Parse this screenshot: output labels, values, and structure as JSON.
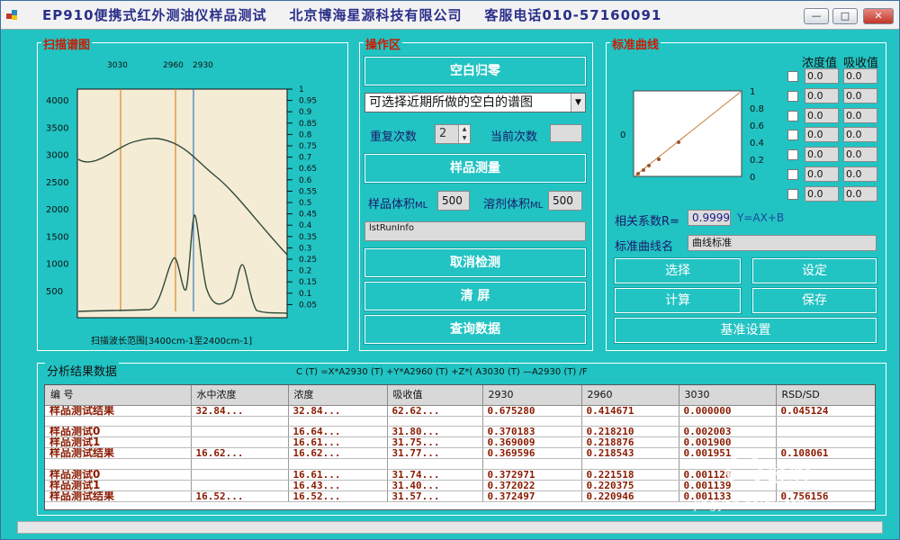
{
  "window": {
    "title": "EP910便携式红外测油仪样品测试    北京博海星源科技有限公司    客服电话010-57160091",
    "minimize": "—",
    "maximize": "□",
    "close": "✕"
  },
  "scan_panel": {
    "title": "扫描谱图",
    "caption": "扫描波长范围[3400cm-1至2400cm-1]",
    "markers": [
      "3030",
      "2960",
      "2930"
    ],
    "left_ticks": [
      "4000",
      "3500",
      "3000",
      "2500",
      "2000",
      "1500",
      "1000",
      "500"
    ],
    "right_ticks": [
      "1",
      "0.95",
      "0.9",
      "0.85",
      "0.8",
      "0.75",
      "0.7",
      "0.65",
      "0.6",
      "0.55",
      "0.5",
      "0.45",
      "0.4",
      "0.35",
      "0.3",
      "0.25",
      "0.2",
      "0.15",
      "0.1",
      "0.05"
    ]
  },
  "ops_panel": {
    "title": "操作区",
    "blank_zero_button": "空白归零",
    "blank_select_value": "可选择近期所做的空白的谱图",
    "repeat_label": "重复次数",
    "repeat_value": "2",
    "current_label": "当前次数",
    "current_value": "",
    "sample_measure_button": "样品测量",
    "sample_volume_label": "样品体积",
    "sample_volume_unit": "ML",
    "sample_volume_value": "500",
    "solvent_volume_label": "溶剂体积",
    "solvent_volume_unit": "ML",
    "solvent_volume_value": "500",
    "run_info": "lstRunInfo",
    "cancel_button": "取消检测",
    "clear_button": "清    屏",
    "query_button": "查询数据"
  },
  "curve_panel": {
    "title": "标准曲线",
    "conc_header": "浓度值",
    "abs_header": "吸收值",
    "rows": [
      {
        "conc": "0.0",
        "abs": "0.0"
      },
      {
        "conc": "0.0",
        "abs": "0.0"
      },
      {
        "conc": "0.0",
        "abs": "0.0"
      },
      {
        "conc": "0.0",
        "abs": "0.0"
      },
      {
        "conc": "0.0",
        "abs": "0.0"
      },
      {
        "conc": "0.0",
        "abs": "0.0"
      },
      {
        "conc": "0.0",
        "abs": "0.0"
      }
    ],
    "mini_left_tick": "0",
    "mini_right_ticks": [
      "1",
      "0.8",
      "0.6",
      "0.4",
      "0.2",
      "0"
    ],
    "r_label": "相关系数R=",
    "r_value": "0.9999",
    "equation": "Y=AX+B",
    "curve_name_label": "标准曲线名",
    "curve_name_value": "曲线标准",
    "select_button": "选择",
    "set_button": "设定",
    "calc_button": "计算",
    "save_button": "保存",
    "baseline_button": "基准设置"
  },
  "results": {
    "title": "分析结果数据",
    "formula": "C (T) =X*A2930 (T) +Y*A2960 (T) +Z*( A3030 (T) —A2930 (T) /F",
    "headers": [
      "编    号",
      "水中浓度",
      "浓度",
      "吸收值",
      "2930",
      "2960",
      "3030",
      "RSD/SD"
    ],
    "rows": [
      [
        "样品测试结果",
        "32.84...",
        "32.84...",
        "62.62...",
        "0.675280",
        "0.414671",
        "0.000000",
        "0.045124"
      ],
      [
        "",
        "",
        "",
        "",
        "",
        "",
        "",
        ""
      ],
      [
        "样品测试0",
        "",
        "16.64...",
        "31.80...",
        "0.370183",
        "0.218210",
        "0.002003",
        ""
      ],
      [
        "样品测试1",
        "",
        "16.61...",
        "31.75...",
        "0.369009",
        "0.218876",
        "0.001900",
        ""
      ],
      [
        "样品测试结果",
        "16.62...",
        "16.62...",
        "31.77...",
        "0.369596",
        "0.218543",
        "0.001951",
        "0.108061"
      ],
      [
        "",
        "",
        "",
        "",
        "",
        "",
        "",
        ""
      ],
      [
        "样品测试0",
        "",
        "16.61...",
        "31.74...",
        "0.372971",
        "0.221518",
        "0.001128",
        ""
      ],
      [
        "样品测试1",
        "",
        "16.43...",
        "31.40...",
        "0.372022",
        "0.220375",
        "0.001139",
        ""
      ],
      [
        "样品测试结果",
        "16.52...",
        "16.52...",
        "31.57...",
        "0.372497",
        "0.220946",
        "0.001133",
        "0.756156"
      ]
    ]
  },
  "watermark": {
    "text": "经验",
    "url": "jingyan.baidu.com"
  }
}
